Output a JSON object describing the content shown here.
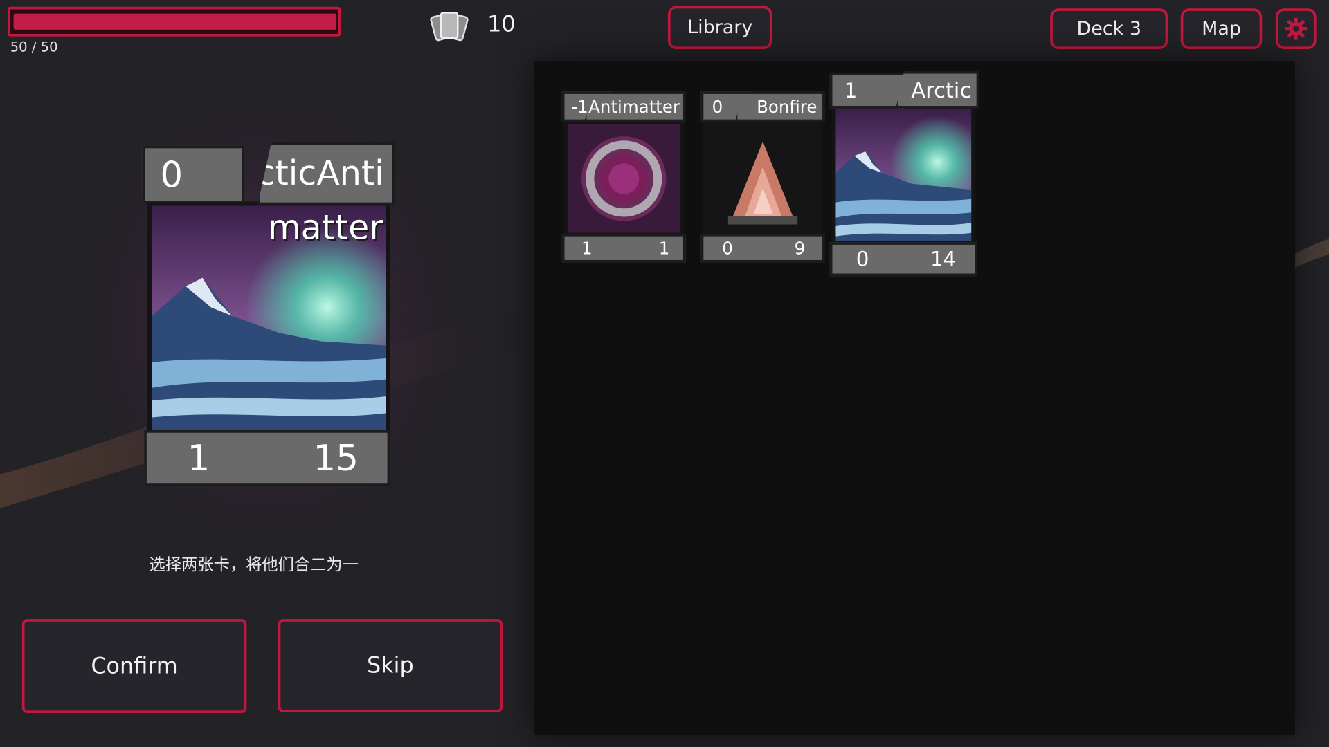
{
  "player": {
    "hp_current": 50,
    "hp_max": 50,
    "hp_fraction": 1.0,
    "hp_text": "50 / 50"
  },
  "deck": {
    "count": "10",
    "icon": "cards-stack-icon"
  },
  "nav": {
    "library": "Library",
    "deck": "Deck 3",
    "map": "Map",
    "settings_icon": "gear-icon"
  },
  "selected_card": {
    "cost": "0",
    "name_line1": "ArcticAnti",
    "name_line2": "matter",
    "stat_left": "1",
    "stat_right": "15",
    "art": "aurora-mountain"
  },
  "hint": "选择两张卡，将他们合二为一",
  "actions": {
    "confirm": "Confirm",
    "skip": "Skip"
  },
  "cards": [
    {
      "cost": "-1",
      "name": "Antimatter",
      "stat_left": "1",
      "stat_right": "1",
      "art": "vortex"
    },
    {
      "cost": "0",
      "name": "Bonfire",
      "stat_left": "0",
      "stat_right": "9",
      "art": "fire"
    },
    {
      "cost": "1",
      "name": "Arctic",
      "stat_left": "0",
      "stat_right": "14",
      "art": "aurora-mountain"
    }
  ],
  "colors": {
    "accent": "#c2183f",
    "bg": "#232226",
    "panel": "#0f0f10",
    "card_frame": "#6a6a6a"
  }
}
